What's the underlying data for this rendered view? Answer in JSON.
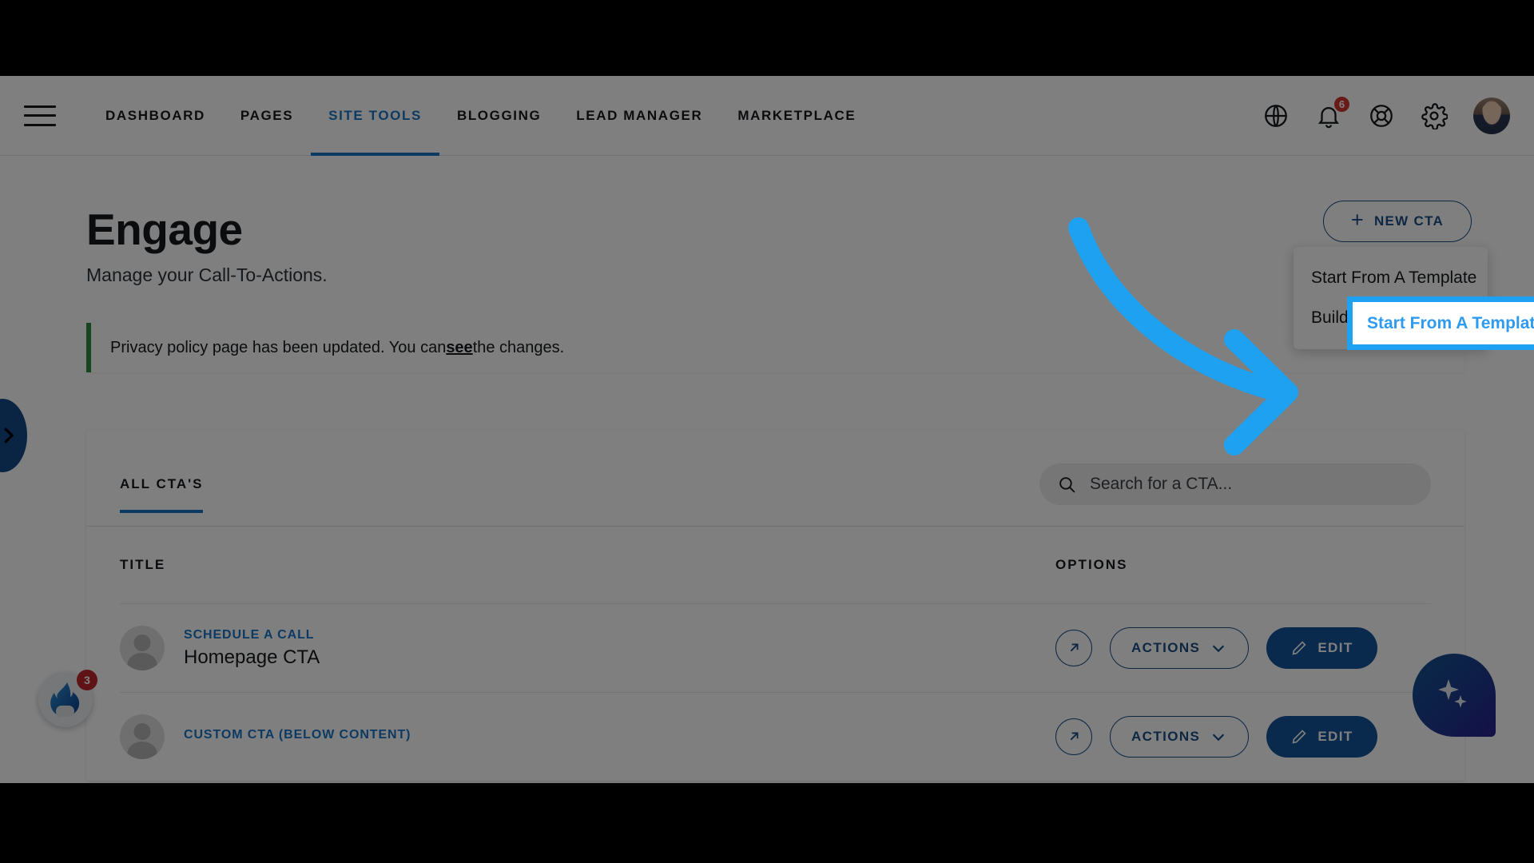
{
  "nav": {
    "menu_icon": "hamburger-icon",
    "links": [
      {
        "label": "DASHBOARD",
        "active": false
      },
      {
        "label": "PAGES",
        "active": false
      },
      {
        "label": "SITE TOOLS",
        "active": true
      },
      {
        "label": "BLOGGING",
        "active": false
      },
      {
        "label": "LEAD MANAGER",
        "active": false
      },
      {
        "label": "MARKETPLACE",
        "active": false
      }
    ],
    "icons": [
      {
        "name": "globe-icon"
      },
      {
        "name": "bell-icon",
        "badge": "6"
      },
      {
        "name": "lifebuoy-help-icon"
      },
      {
        "name": "gear-icon"
      },
      {
        "name": "user-avatar"
      }
    ],
    "notification_count": "6"
  },
  "page": {
    "title": "Engage",
    "subtitle": "Manage your Call-To-Actions."
  },
  "notice": {
    "text_before": "Privacy policy page has been updated. You can ",
    "link": "see",
    "text_after": " the changes.",
    "accent_color": "#2e8b45"
  },
  "new_cta": {
    "button_label": "NEW CTA",
    "plus_icon": "plus-icon",
    "menu": [
      {
        "label": "Start From A Template",
        "highlighted": true
      },
      {
        "label": "Build A Custom CTA",
        "highlighted": false
      }
    ]
  },
  "card": {
    "tab_label": "ALL CTA'S",
    "search": {
      "placeholder": "Search for a CTA...",
      "value": "",
      "icon": "search-icon"
    },
    "columns": {
      "title": "TITLE",
      "options": "OPTIONS"
    },
    "rows": [
      {
        "kind": "SCHEDULE A CALL",
        "name": "Homepage CTA",
        "open_icon": "external-link-icon",
        "actions_label": "ACTIONS",
        "edit_label": "EDIT",
        "edit_icon": "pencil-icon"
      },
      {
        "kind": "CUSTOM CTA (BELOW CONTENT)",
        "name": "",
        "open_icon": "external-link-icon",
        "actions_label": "ACTIONS",
        "edit_label": "EDIT",
        "edit_icon": "pencil-icon"
      }
    ]
  },
  "widgets": {
    "side_tab_icon": "chevron-right-icon",
    "chat_icon": "flame-chat-icon",
    "chat_badge": "3",
    "ai_icon": "sparkle-icon"
  },
  "annotation": {
    "arrow_color": "#1ea1f0",
    "highlight_color": "#1ea1f0",
    "highlight_label": "Start From A Template"
  }
}
